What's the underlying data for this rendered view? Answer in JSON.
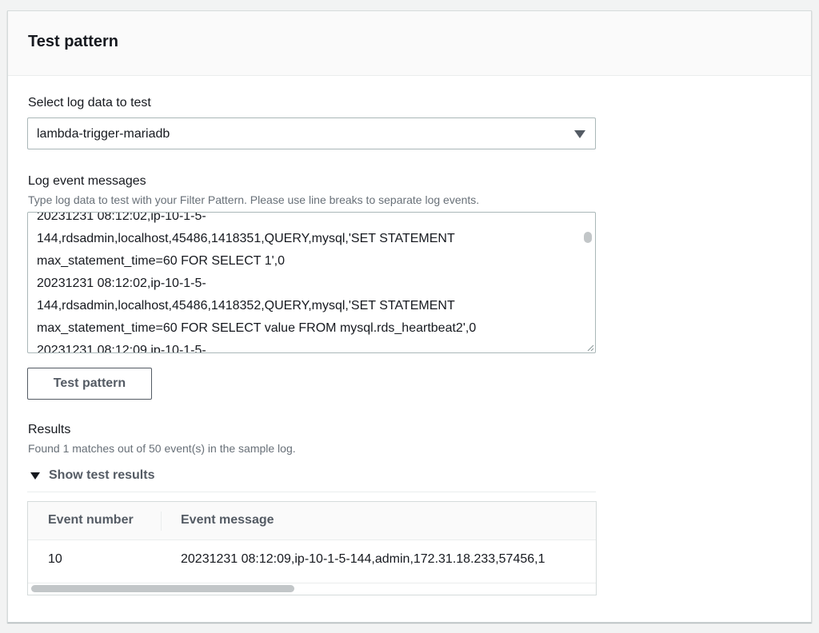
{
  "panel": {
    "title": "Test pattern"
  },
  "log_data": {
    "label": "Select log data to test",
    "selected": "lambda-trigger-mariadb"
  },
  "log_events": {
    "label": "Log event messages",
    "description": "Type log data to test with your Filter Pattern. Please use line breaks to separate log events.",
    "lines": [
      "20231231 08:12:02,ip-10-1-5-",
      "144,rdsadmin,localhost,45486,1418351,QUERY,mysql,'SET STATEMENT",
      "max_statement_time=60 FOR SELECT 1',0",
      "20231231 08:12:02,ip-10-1-5-",
      "144,rdsadmin,localhost,45486,1418352,QUERY,mysql,'SET STATEMENT",
      "max_statement_time=60 FOR SELECT value FROM mysql.rds_heartbeat2',0",
      "20231231 08:12:09,ip-10-1-5-"
    ]
  },
  "test_button": {
    "label": "Test pattern"
  },
  "results": {
    "label": "Results",
    "summary": "Found 1 matches out of 50 event(s) in the sample log.",
    "toggle_label": "Show test results",
    "columns": [
      "Event number",
      "Event message"
    ],
    "rows": [
      {
        "event_number": "10",
        "event_message": "20231231 08:12:09,ip-10-1-5-144,admin,172.31.18.233,57456,1"
      }
    ]
  }
}
